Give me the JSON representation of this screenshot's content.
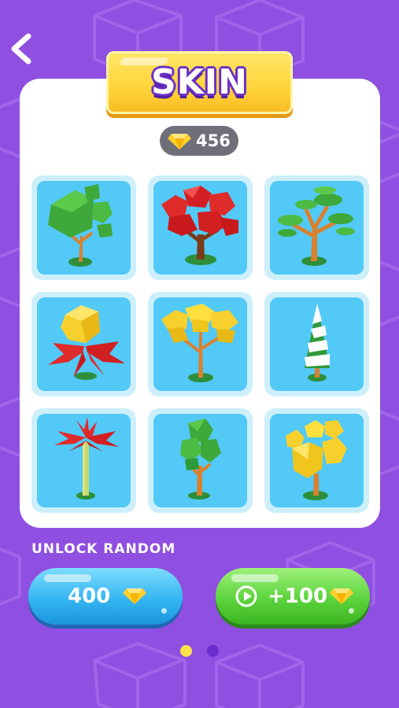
{
  "screen": {
    "title": "SKIN"
  },
  "currency": {
    "gem_count": "456",
    "icon": "gem-icon"
  },
  "skins": [
    {
      "name": "green-cube-tree",
      "icon": "tree-icon"
    },
    {
      "name": "red-tree",
      "icon": "tree-icon"
    },
    {
      "name": "bonsai-tree",
      "icon": "tree-icon"
    },
    {
      "name": "yellow-red-flower-tree",
      "icon": "tree-icon"
    },
    {
      "name": "yellow-acacia-tree",
      "icon": "tree-icon"
    },
    {
      "name": "snowy-pine-tree",
      "icon": "tree-icon"
    },
    {
      "name": "palm-tree",
      "icon": "tree-icon"
    },
    {
      "name": "green-tall-tree",
      "icon": "tree-icon"
    },
    {
      "name": "yellow-bush-tree",
      "icon": "tree-icon"
    }
  ],
  "unlock": {
    "label": "UNLOCK RANDOM",
    "price": "400",
    "reward": "+100"
  },
  "pagination": {
    "current": 1,
    "total": 2
  },
  "colors": {
    "background": "#8f4fe0",
    "tile": "#52c9f6",
    "gold": "#ffd43a",
    "blue_button": "#35b6f2",
    "green_button": "#5cd43d"
  }
}
